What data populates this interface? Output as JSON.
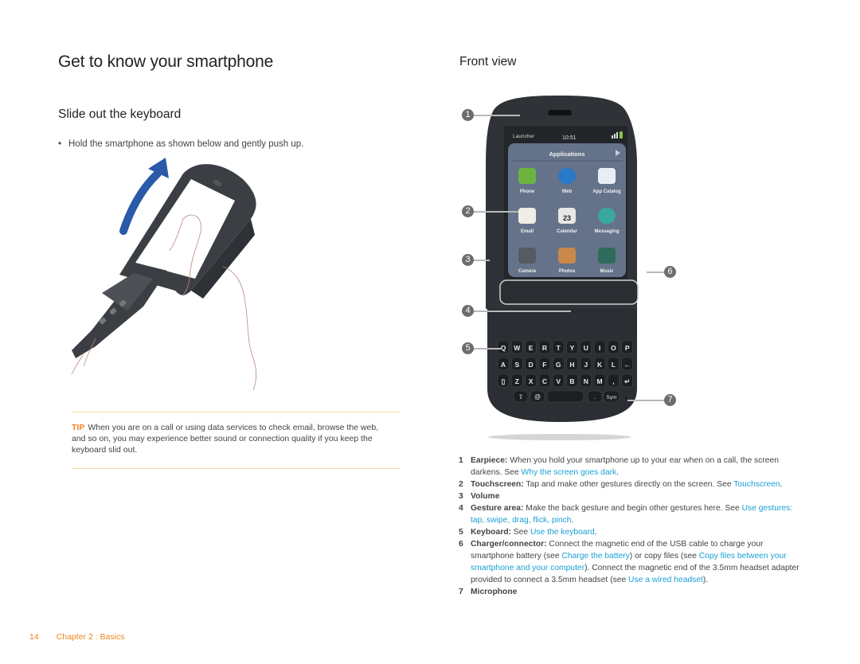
{
  "page": {
    "title": "Get to know your smartphone",
    "section_left": "Slide out the keyboard",
    "bullet": "Hold the smartphone as shown below and gently push up.",
    "section_right": "Front view"
  },
  "tip": {
    "label": "TIP",
    "text": "When you are on a call or using data services to check email, browse the web, and so on, you may experience better sound or connection quality if you keep the keyboard slid out."
  },
  "phone_screen": {
    "launcher": "Launcher",
    "time": "10:51",
    "panel_title": "Applications",
    "apps": [
      {
        "label": "Phone",
        "icon": "phone-app-icon"
      },
      {
        "label": "Web",
        "icon": "globe-icon"
      },
      {
        "label": "App Catalog",
        "icon": "shopping-bag-icon"
      },
      {
        "label": "Email",
        "icon": "envelope-icon"
      },
      {
        "label": "Calendar",
        "icon": "calendar-icon",
        "badge": "23"
      },
      {
        "label": "Messaging",
        "icon": "chat-bubbles-icon"
      },
      {
        "label": "Camera",
        "icon": "camera-icon"
      },
      {
        "label": "Photos",
        "icon": "photos-icon"
      },
      {
        "label": "Music",
        "icon": "music-icon"
      }
    ],
    "keyboard_rows": [
      [
        "Q",
        "W",
        "E",
        "R",
        "T",
        "Y",
        "U",
        "I",
        "O",
        "P"
      ],
      [
        "A",
        "S",
        "D",
        "F",
        "G",
        "H",
        "J",
        "K",
        "L",
        "←"
      ],
      [
        "▯",
        "Z",
        "X",
        "C",
        "V",
        "B",
        "N",
        "M",
        ",",
        "↵"
      ],
      [
        "⇧",
        "@",
        "space",
        ".",
        "Sym"
      ]
    ]
  },
  "callouts": [
    "1",
    "2",
    "3",
    "4",
    "5",
    "6",
    "7"
  ],
  "legend": [
    {
      "num": "1",
      "term": "Earpiece:",
      "text": " When you hold your smartphone up to your ear when on a call, the screen darkens. See ",
      "links": [
        "Why the screen goes dark"
      ],
      "after": "."
    },
    {
      "num": "2",
      "term": "Touchscreen:",
      "text": " Tap and make other gestures directly on the screen. See ",
      "links": [
        "Touchscreen"
      ],
      "after": "."
    },
    {
      "num": "3",
      "term": "Volume",
      "text": "",
      "links": [],
      "after": ""
    },
    {
      "num": "4",
      "term": "Gesture area:",
      "text": " Make the back gesture and begin other gestures here. See ",
      "links": [
        "Use gestures: tap, swipe, drag, flick, pinch"
      ],
      "after": "."
    },
    {
      "num": "5",
      "term": "Keyboard:",
      "text": " See ",
      "links": [
        "Use the keyboard"
      ],
      "after": "."
    },
    {
      "num": "6",
      "term": "Charger/connector:",
      "text_parts": [
        " Connect the magnetic end of the USB cable to charge your smartphone battery (see ",
        {
          "link": "Charge the battery"
        },
        ") or copy files (see ",
        {
          "link": "Copy files between your smartphone and your computer"
        },
        "). Connect the magnetic end of the 3.5mm headset adapter provided to connect a 3.5mm headset (see ",
        {
          "link": "Use a wired headset"
        },
        ")."
      ]
    },
    {
      "num": "7",
      "term": "Microphone",
      "text": "",
      "links": [],
      "after": ""
    }
  ],
  "footer": {
    "page_number": "14",
    "chapter": "Chapter 2  :  Basics"
  },
  "colors": {
    "accent_orange": "#f0841f",
    "link_blue": "#1aa0d6",
    "tip_border": "#f6d9a8",
    "arrow_blue": "#2a5aa8",
    "callout_gray": "#6d6d6f"
  }
}
